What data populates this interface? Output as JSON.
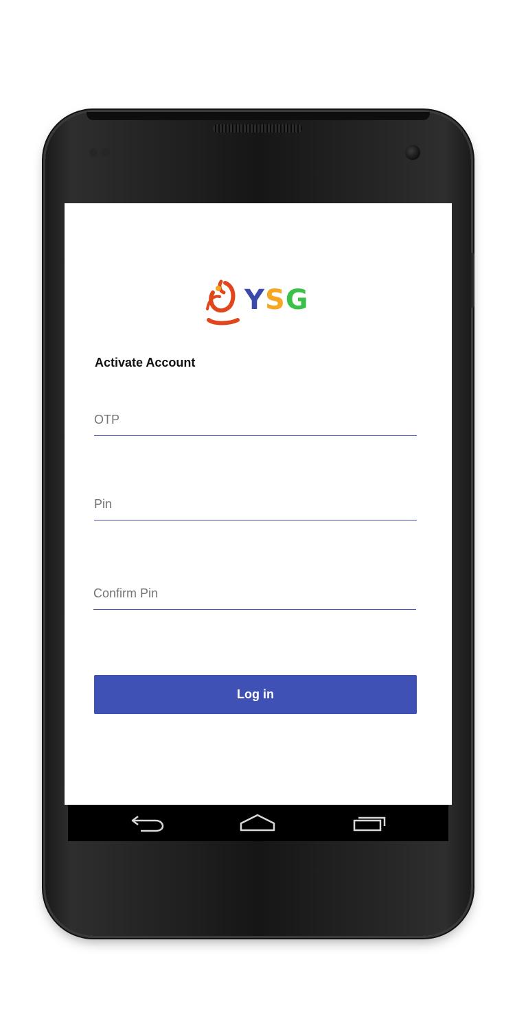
{
  "app": {
    "logo_text": {
      "part1": "Y",
      "part2": "S",
      "part3": "G"
    }
  },
  "form": {
    "title": "Activate Account",
    "otp_placeholder": "OTP",
    "pin_placeholder": "Pin",
    "confirm_pin_placeholder": "Confirm Pin",
    "submit_label": "Log in"
  },
  "navbar": {
    "icons": [
      "back-icon",
      "home-icon",
      "recent-apps-icon"
    ]
  },
  "colors": {
    "accent": "#3f51b5",
    "logo_orange": "#e0451c",
    "logo_blue": "#3b4aa8",
    "logo_yellow": "#f5a623",
    "logo_green": "#3cc04a"
  }
}
